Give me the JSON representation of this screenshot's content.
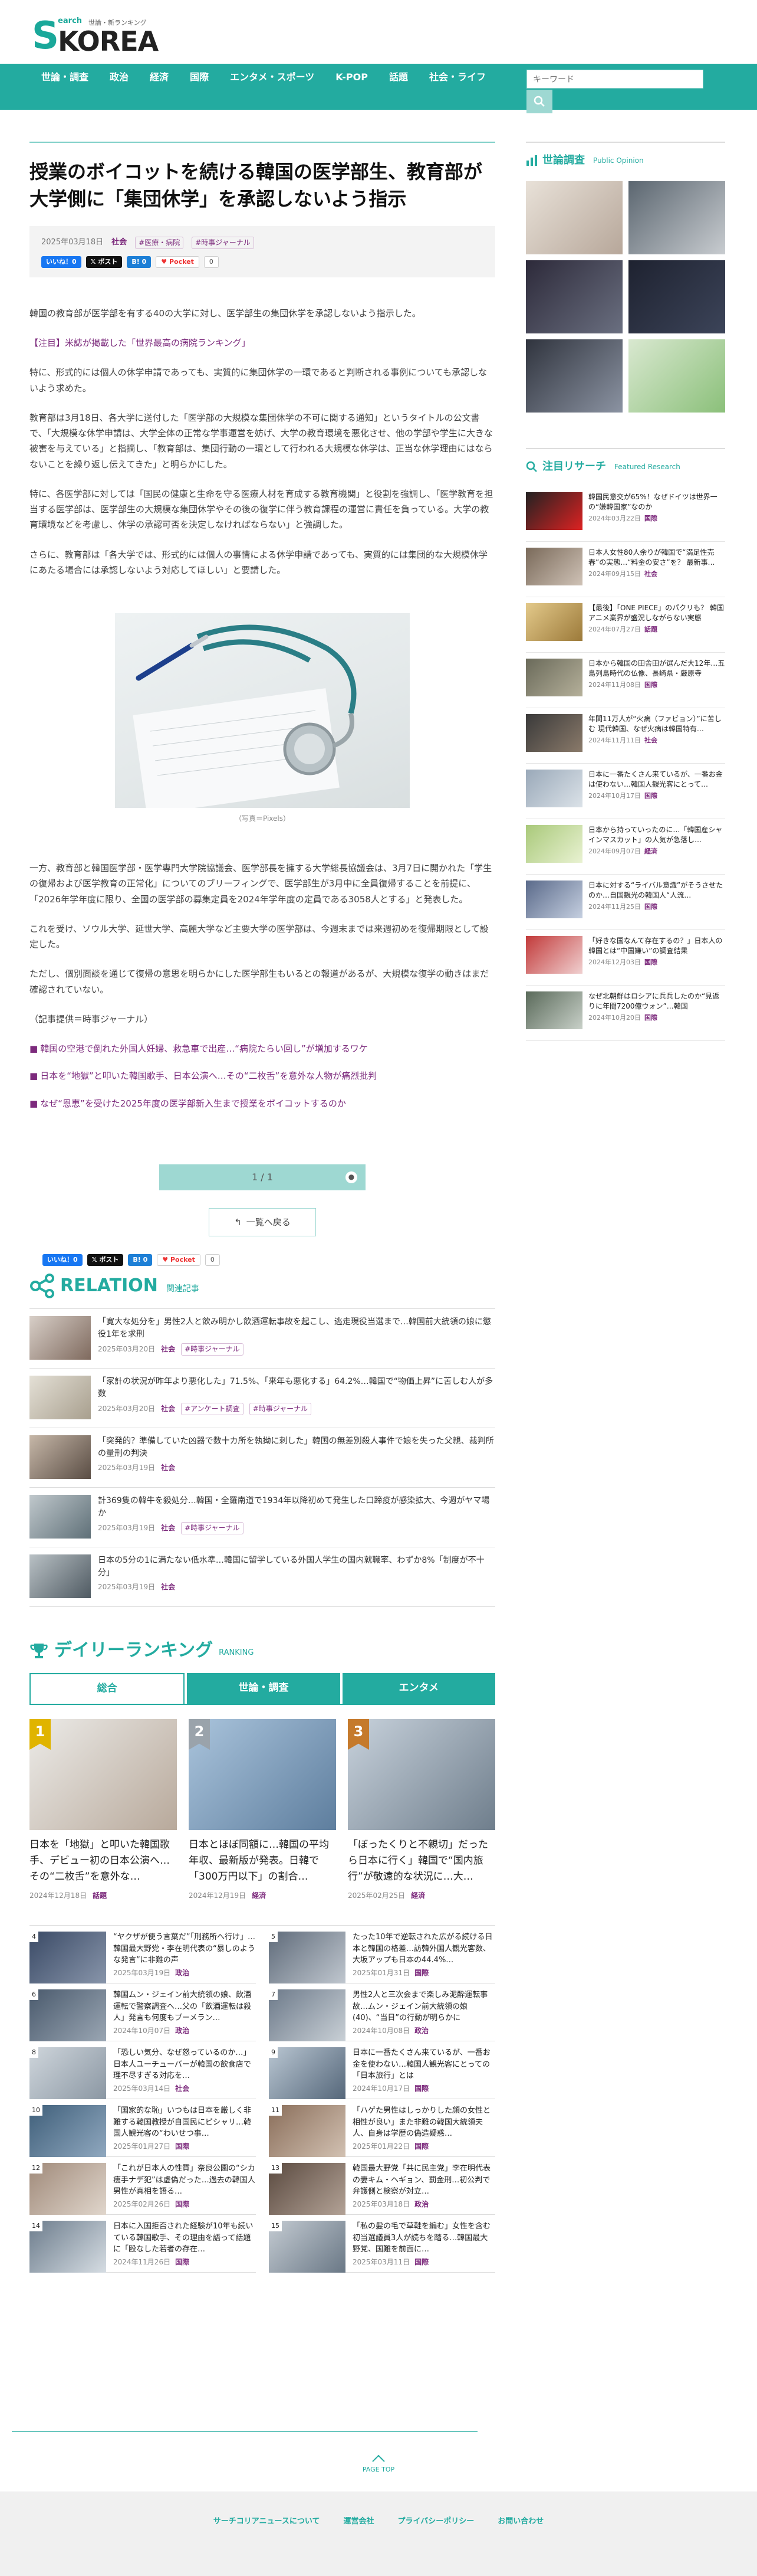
{
  "site": {
    "logo_s": "S",
    "logo_top": "earch",
    "logo_main": "KOREA",
    "logo_tagline": "世論・新ランキング"
  },
  "nav": {
    "items": [
      "世論・調査",
      "政治",
      "経済",
      "国際",
      "エンタメ・スポーツ",
      "K-POP",
      "話題",
      "社会・ライフ"
    ],
    "search_placeholder": "キーワード"
  },
  "article": {
    "title": "授業のボイコットを続ける韓国の医学部生、教育部が大学側に「集団休学」を承認しないよう指示",
    "date": "2025年03月18日",
    "category": "社会",
    "tags": [
      "#医療・病院",
      "#時事ジャーナル"
    ],
    "share": {
      "like": "いいね！0",
      "post": "ポスト",
      "b": "B!",
      "b_count": "0",
      "pocket": "Pocket",
      "pocket_count": "0"
    },
    "paragraphs": [
      "韓国の教育部が医学部を有する40の大学に対し、医学部生の集団休学を承認しないよう指示した。",
      "【注目】米誌が掲載した「世界最高の病院ランキング」",
      "特に、形式的には個人の休学申請であっても、実質的に集団休学の一環であると判断される事例についても承認しないよう求めた。",
      "教育部は3月18日、各大学に送付した「医学部の大規模な集団休学の不可に関する通知」というタイトルの公文書で、「大規模な休学申請は、大学全体の正常な学事運営を妨げ、大学の教育環境を悪化させ、他の学部や学生に大きな被害を与えている」と指摘し、「教育部は、集団行動の一環として行われる大規模な休学は、正当な休学理由にはならないことを繰り返し伝えてきた」と明らかにした。",
      "特に、各医学部に対しては「国民の健康と生命を守る医療人材を育成する教育機関」と役割を強調し、「医学教育を担当する医学部は、医学部生の大規模な集団休学やその後の復学に伴う教育課程の運営に責任を負っている。大学の教育環境などを考慮し、休学の承認可否を決定しなければならない」と強調した。",
      "さらに、教育部は「各大学では、形式的には個人の事情による休学申請であっても、実質的には集団的な大規模休学にあたる場合には承認しないよう対応してほしい」と要請した。"
    ],
    "photo_caption": "（写真＝Pixels）",
    "paragraphs2": [
      "一方、教育部と韓国医学部・医学専門大学院協議会、医学部長を擁する大学総長協議会は、3月7日に開かれた「学生の復帰および医学教育の正常化」についてのブリーフィングで、医学部生が3月中に全員復帰することを前提に、「2026年学年度に限り、全国の医学部の募集定員を2024年学年度の定員である3058人とする」と発表した。",
      "これを受け、ソウル大学、延世大学、高麗大学など主要大学の医学部は、今週末までは来週初めを復帰期限として設定した。",
      "ただし、個別面談を通じて復帰の意思を明らかにした医学部生もいるとの報道があるが、大規模な復学の動きはまだ確認されていない。",
      "（記事提供＝時事ジャーナル）"
    ],
    "links": [
      "韓国の空港で倒れた外国人妊婦、救急車で出産…“病院たらい回し”が増加するワケ",
      "日本を“地獄”と叩いた韓国歌手、日本公演へ…その“二枚舌”を意外な人物が痛烈批判",
      "なぜ“恩恵”を受けた2025年度の医学部新入生まで授業をボイコットするのか"
    ],
    "pager": "1 / 1",
    "back_label": "一覧へ戻る"
  },
  "relation": {
    "title": "RELATION",
    "subtitle": "関連記事",
    "items": [
      {
        "text": "「寛大な処分を」男性2人と飲み明かし飲酒運転事故を起こし、逃走現役当選まで…韓国前大統領の娘に懲役1年を求刑",
        "date": "2025年03月20日",
        "cat": "社会",
        "tag": "#時事ジャーナル"
      },
      {
        "text": "「家計の状況が昨年より悪化した」71.5%、「来年も悪化する」64.2%…韓国で“物価上昇”に苦しむ人が多数",
        "date": "2025年03月20日",
        "cat": "社会",
        "tag": "#アンケート調査",
        "tag2": "#時事ジャーナル"
      },
      {
        "text": "「突発的？準備していた凶器で数十カ所を執拗に刺した」韓国の無差別殺人事件で娘を失った父親、裁判所の量刑の判決",
        "date": "2025年03月19日",
        "cat": "社会",
        "tag": ""
      },
      {
        "text": "計369隻の韓牛を殺処分…韓国・全羅南道で1934年以降初めて発生した口蹄疫が感染拡大、今週がヤマ場か",
        "date": "2025年03月19日",
        "cat": "社会",
        "tag": "#時事ジャーナル"
      },
      {
        "text": "日本の5分の1に満たない低水準…韓国に留学している外国人学生の国内就職率、わずか8%「制度が不十分」",
        "date": "2025年03月19日",
        "cat": "社会",
        "tag": ""
      }
    ]
  },
  "ranking": {
    "title": "デイリーランキング",
    "subtitle": "RANKING",
    "tabs": [
      "総合",
      "世論・調査",
      "エンタメ"
    ],
    "top3": [
      {
        "num": "1",
        "text": "日本を「地獄」と叩いた韓国歌手、デビュー初の日本公演へ…その“二枚舌”を意外な…",
        "date": "2024年12月18日",
        "cat": "話題"
      },
      {
        "num": "2",
        "text": "日本とほぼ同額に…韓国の平均年収、最新版が発表。日韓で「300万円以下」の割合…",
        "date": "2024年12月19日",
        "cat": "経済"
      },
      {
        "num": "3",
        "text": "「ぼったくりと不親切」だったら日本に行く」韓国で“国内旅行”が敬遠的な状況に…大…",
        "date": "2025年02月25日",
        "cat": "経済"
      }
    ],
    "items": [
      {
        "num": "4",
        "text": "“ヤクザが使う言葉だ”「刑務所へ行け」…韓国最大野党・李在明代表の“暴しのような発言”に非難の声",
        "date": "2025年03月19日",
        "cat": "政治"
      },
      {
        "num": "5",
        "text": "たった10年で逆転された広がる続ける日本と韓国の格差…訪韓外国人観光客数、大坂アップも日本の44.4%…",
        "date": "2025年01月31日",
        "cat": "国際"
      },
      {
        "num": "6",
        "text": "韓国ムン・ジェイン前大統領の娘、飲酒運転で警察調査へ…父の「飲酒運転は殺人」発言も何度もブーメラン…",
        "date": "2024年10月07日",
        "cat": "政治"
      },
      {
        "num": "7",
        "text": "男性2人と三次会まで楽しみ泥酔運転事故…ムン・ジェイン前大統領の娘(40)、“当日”の行動が明らかに",
        "date": "2024年10月08日",
        "cat": "政治"
      },
      {
        "num": "8",
        "text": "「恐しい気分、なぜ怒っているのか…」日本人ユーチューバーが韓国の飲食店で理不尽すぎる対応を…",
        "date": "2025年03月14日",
        "cat": "社会"
      },
      {
        "num": "9",
        "text": "日本に一番たくさん来ているが、一番お金を使わない…韓国人観光客にとっての「日本旅行」とは",
        "date": "2024年10月17日",
        "cat": "国際"
      },
      {
        "num": "10",
        "text": "「国家的な恥」いつもは日本を厳しく非難する韓国教授が自国民にピシャリ…韓国人観光客の“わいせつ事…",
        "date": "2025年01月27日",
        "cat": "国際"
      },
      {
        "num": "11",
        "text": "「ハゲた男性はしっかりした顔の女性と相性が良い」また非難の韓国大統領夫人、自身は学歴の偽造疑惑…",
        "date": "2025年01月22日",
        "cat": "国際"
      },
      {
        "num": "12",
        "text": "「これが日本人の性質」奈良公園の“シカ痩手ナデ犯”は虚偽だった…過去の韓国人男性が真相を語る…",
        "date": "2025年02月26日",
        "cat": "国際"
      },
      {
        "num": "13",
        "text": "韓国最大野党「共に民主党」李在明代表の妻キム・ヘギョン、罰金刑…初公判で弁護側と検察が対立…",
        "date": "2025年03月18日",
        "cat": "政治"
      },
      {
        "num": "14",
        "text": "日本に入国拒否された経験が10年も続いている韓国歌手、その理由を語って話題に「殴なした若者の存在…",
        "date": "2024年11月26日",
        "cat": "国際"
      },
      {
        "num": "15",
        "text": "「私の髪の毛で草鞋を編む」女性を含む初当選議員3人が読ちを踏る…韓国最大野党、国難を前面に…",
        "date": "2025年03月11日",
        "cat": "国際"
      }
    ]
  },
  "side": {
    "opinion": {
      "title": "世論調査",
      "subtitle": "Public Opinion"
    },
    "research": {
      "title": "注目リサーチ",
      "subtitle": "Featured Research",
      "items": [
        {
          "text": "韓国民意交が65%！なぜドイツは世界一の“嫌韓国家”なのか",
          "date": "2024年03月22日",
          "cat": "国際"
        },
        {
          "text": "日本人女性80人余りが韓国で“満足性売春”の実態…“料金の安さ”を？ 最新事…",
          "date": "2024年09月15日",
          "cat": "社会"
        },
        {
          "text": "【最後】「ONE PIECE」のパクリも？ 韓国アニメ業界が盛況しながらない実態",
          "date": "2024年07月27日",
          "cat": "話題"
        },
        {
          "text": "日本から韓国の田舎田が選んだ大12年…五島列島時代の仏像、長崎県・厳原寺",
          "date": "2024年11月08日",
          "cat": "国際"
        },
        {
          "text": "年間11万人が“火病（ファビョン）”に苦しむ 現代韓国、なぜ火病は韓国特有…",
          "date": "2024年11月11日",
          "cat": "社会"
        },
        {
          "text": "日本に一番たくさん来ているが、一番お金は使わない…韓国人観光客にとって…",
          "date": "2024年10月17日",
          "cat": "国際"
        },
        {
          "text": "日本から持っていったのに…「韓国産シャインマスカット」の人気が急落し…",
          "date": "2024年09月07日",
          "cat": "経済"
        },
        {
          "text": "日本に対する“ライバル意識”がそうさせたのか…自国観光の韓国人“人流…",
          "date": "2024年11月25日",
          "cat": "国際"
        },
        {
          "text": "「好きな国なんて存在するの？」日本人の韓国とは“中国嫌い”の調査結果",
          "date": "2024年12月03日",
          "cat": "国際"
        },
        {
          "text": "なぜ北朝鮮はロシアに兵兵したのか“見返りに年間7200億ウォン”…韓国",
          "date": "2024年10月20日",
          "cat": "国際"
        }
      ]
    }
  },
  "footer": {
    "links": [
      "サーチコリアニュースについて",
      "運営会社",
      "プライバシーポリシー",
      "お問い合わせ"
    ],
    "page_top": "PAGE TOP"
  }
}
